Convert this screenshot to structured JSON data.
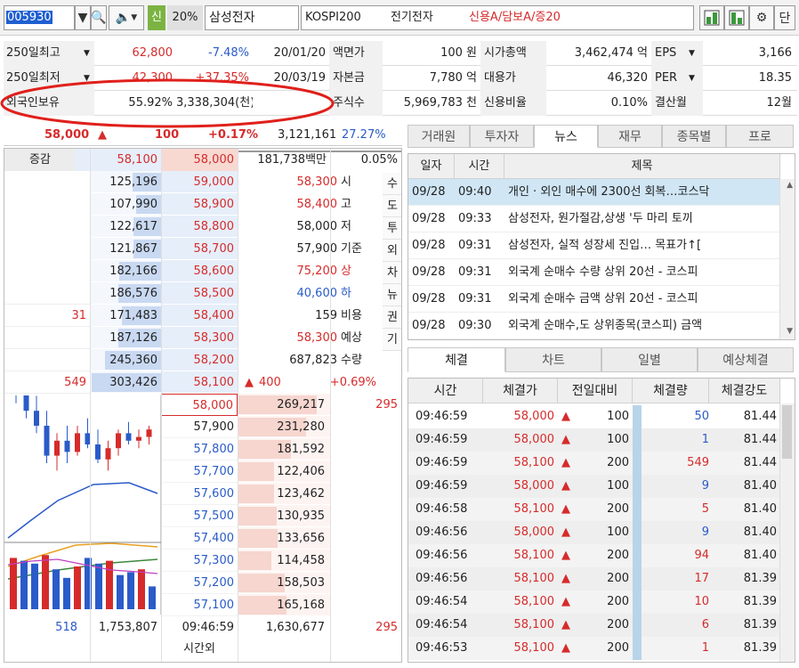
{
  "top": {
    "code": "005930",
    "badge_sin": "신",
    "margin_pct": "20%",
    "name": "삼성전자",
    "market": "KOSPI200",
    "sector": "전기전자",
    "credit": "신용A/담보A/증20",
    "end_label": "단"
  },
  "info": {
    "rows": [
      {
        "label": "250일최고",
        "v1": "62,800",
        "v2": "-7.48%",
        "v3": "20/01/20",
        "l2": "액면가",
        "v4": "100 원",
        "l3": "시가총액",
        "v5": "3,462,474 억",
        "l4": "EPS",
        "v6": "3,166"
      },
      {
        "label": "250일최저",
        "v1": "42,300",
        "v2": "+37.35%",
        "v3": "20/03/19",
        "l2": "자본금",
        "v4": "7,780 억",
        "l3": "대용가",
        "v5": "46,320",
        "l4": "PER",
        "v6": "18.35"
      },
      {
        "label": "외국인보유",
        "v1": "55.92%",
        "v2": "3,338,304(천)",
        "v3": "",
        "l2": "주식수",
        "v4": "5,969,783 천",
        "l3": "신용비율",
        "v5": "0.10%",
        "l4": "결산월",
        "v6": "12월"
      }
    ]
  },
  "price": {
    "current": "58,000",
    "arrow": "▲",
    "change": "100",
    "pct": "+0.17%",
    "volume": "3,121,161",
    "turnover": "27.27%"
  },
  "order_head": {
    "label": "증감",
    "ask_price": "58,100",
    "bid_price": "58,000",
    "amount": "181,738백만",
    "pct": "0.05%"
  },
  "asks": [
    {
      "qty": "125,196",
      "price": "59,000",
      "bar": 0.41
    },
    {
      "qty": "107,990",
      "price": "58,900",
      "bar": 0.36
    },
    {
      "qty": "122,617",
      "price": "58,800",
      "bar": 0.4
    },
    {
      "qty": "121,867",
      "price": "58,700",
      "bar": 0.4
    },
    {
      "qty": "182,166",
      "price": "58,600",
      "bar": 0.6
    },
    {
      "qty": "186,576",
      "price": "58,500",
      "bar": 0.62,
      "diff": ""
    },
    {
      "qty": "171,483",
      "price": "58,400",
      "bar": 0.57,
      "diff": "31"
    },
    {
      "qty": "187,126",
      "price": "58,300",
      "bar": 0.62,
      "diff": ""
    },
    {
      "qty": "245,360",
      "price": "58,200",
      "bar": 0.81,
      "diff": ""
    },
    {
      "qty": "303,426",
      "price": "58,100",
      "bar": 1.0,
      "diff": "549"
    }
  ],
  "stats": [
    {
      "val": "58,300",
      "lbl": "시"
    },
    {
      "val": "58,400",
      "lbl": "고"
    },
    {
      "val": "58,000",
      "lbl": "저"
    },
    {
      "val": "57,900",
      "lbl": "기준"
    },
    {
      "val": "75,200",
      "lbl": "상"
    },
    {
      "val": "40,600",
      "lbl": "하"
    },
    {
      "val": "159",
      "lbl": "비용"
    },
    {
      "val": "58,300",
      "lbl": "예상"
    },
    {
      "val": "687,823",
      "lbl": "수량"
    }
  ],
  "exp_change": {
    "arrow": "▲",
    "val": "400",
    "pct": "+0.69%"
  },
  "side_buttons": [
    "수",
    "도",
    "투",
    "외",
    "차",
    "뉴",
    "권",
    "기"
  ],
  "bids": [
    {
      "price": "58,000",
      "qty": "269,217",
      "diff": "295",
      "bar": 0.86
    },
    {
      "price": "57,900",
      "qty": "231,280",
      "diff": "",
      "bar": 0.74
    },
    {
      "price": "57,800",
      "qty": "181,592",
      "diff": "",
      "bar": 0.58
    },
    {
      "price": "57,700",
      "qty": "122,406",
      "diff": "",
      "bar": 0.39
    },
    {
      "price": "57,600",
      "qty": "123,462",
      "diff": "",
      "bar": 0.39
    },
    {
      "price": "57,500",
      "qty": "130,935",
      "diff": "",
      "bar": 0.42
    },
    {
      "price": "57,400",
      "qty": "133,656",
      "diff": "",
      "bar": 0.43
    },
    {
      "price": "57,300",
      "qty": "114,458",
      "diff": "",
      "bar": 0.37
    },
    {
      "price": "57,200",
      "qty": "158,503",
      "diff": "",
      "bar": 0.51
    },
    {
      "price": "57,100",
      "qty": "165,168",
      "diff": "",
      "bar": 0.53
    }
  ],
  "totals": {
    "ask_diff": "518",
    "ask_total": "1,753,807",
    "time": "09:46:59",
    "bid_total": "1,630,677",
    "bid_diff": "295",
    "after": "시간외"
  },
  "news": {
    "tabs": [
      "거래원",
      "투자자",
      "뉴스",
      "재무",
      "종목별",
      "프로"
    ],
    "active_tab": 2,
    "headers": [
      "일자",
      "시간",
      "제목"
    ],
    "rows": [
      {
        "date": "09/28",
        "time": "09:40",
        "title": "개인 · 외인 매수에 2300선 회복…코스닥"
      },
      {
        "date": "09/28",
        "time": "09:33",
        "title": "삼성전자, 원가절감,상생 '두 마리 토끼"
      },
      {
        "date": "09/28",
        "time": "09:31",
        "title": "삼성전자, 실적 성장세 진입… 목표가↑["
      },
      {
        "date": "09/28",
        "time": "09:31",
        "title": "외국계 순매수 수량 상위 20선 - 코스피"
      },
      {
        "date": "09/28",
        "time": "09:31",
        "title": "외국계 순매수 금액 상위 20선 - 코스피"
      },
      {
        "date": "09/28",
        "time": "09:30",
        "title": "외국계 순매수,도 상위종목(코스피) 금액"
      }
    ]
  },
  "trades": {
    "tabs": [
      "체결",
      "차트",
      "일별",
      "예상체결"
    ],
    "active_tab": 0,
    "headers": [
      "시간",
      "체결가",
      "전일대비",
      "체결량",
      "체결강도"
    ],
    "rows": [
      {
        "time": "09:46:59",
        "price": "58,000",
        "arrow": "▲",
        "diff": "100",
        "qty": "50",
        "qty_color": "blue",
        "strength": "81.44"
      },
      {
        "time": "09:46:59",
        "price": "58,000",
        "arrow": "▲",
        "diff": "100",
        "qty": "1",
        "qty_color": "blue",
        "strength": "81.44"
      },
      {
        "time": "09:46:59",
        "price": "58,100",
        "arrow": "▲",
        "diff": "200",
        "qty": "549",
        "qty_color": "red",
        "strength": "81.44"
      },
      {
        "time": "09:46:59",
        "price": "58,000",
        "arrow": "▲",
        "diff": "100",
        "qty": "9",
        "qty_color": "blue",
        "strength": "81.40"
      },
      {
        "time": "09:46:58",
        "price": "58,100",
        "arrow": "▲",
        "diff": "200",
        "qty": "5",
        "qty_color": "red",
        "strength": "81.40"
      },
      {
        "time": "09:46:56",
        "price": "58,000",
        "arrow": "▲",
        "diff": "100",
        "qty": "9",
        "qty_color": "blue",
        "strength": "81.40"
      },
      {
        "time": "09:46:56",
        "price": "58,100",
        "arrow": "▲",
        "diff": "200",
        "qty": "94",
        "qty_color": "red",
        "strength": "81.40"
      },
      {
        "time": "09:46:56",
        "price": "58,100",
        "arrow": "▲",
        "diff": "200",
        "qty": "17",
        "qty_color": "red",
        "strength": "81.39"
      },
      {
        "time": "09:46:54",
        "price": "58,100",
        "arrow": "▲",
        "diff": "200",
        "qty": "10",
        "qty_color": "red",
        "strength": "81.39"
      },
      {
        "time": "09:46:54",
        "price": "58,100",
        "arrow": "▲",
        "diff": "200",
        "qty": "6",
        "qty_color": "red",
        "strength": "81.39"
      },
      {
        "time": "09:46:53",
        "price": "58,100",
        "arrow": "▲",
        "diff": "200",
        "qty": "1",
        "qty_color": "red",
        "strength": "81.39"
      }
    ]
  },
  "colors": {
    "up": "#d62b2b",
    "down": "#2a5bc9",
    "ask_bg": "#e6eefa",
    "bid_bg": "#fbecec",
    "highlight": "#d0e6f5",
    "annotation": "#e0201b"
  },
  "mini_chart": {
    "candles": [
      [
        92,
        96,
        86,
        90
      ],
      [
        90,
        95,
        82,
        84
      ],
      [
        84,
        88,
        78,
        80
      ],
      [
        80,
        84,
        70,
        72
      ],
      [
        72,
        78,
        68,
        76
      ],
      [
        76,
        80,
        70,
        73
      ],
      [
        73,
        80,
        72,
        78
      ],
      [
        78,
        82,
        74,
        75
      ],
      [
        75,
        79,
        70,
        71
      ],
      [
        71,
        76,
        68,
        74
      ],
      [
        74,
        79,
        72,
        78
      ],
      [
        78,
        81,
        75,
        76
      ],
      [
        76,
        79,
        74,
        77
      ],
      [
        77,
        80,
        75,
        79
      ]
    ],
    "volume": [
      0.9,
      0.85,
      0.8,
      0.95,
      0.7,
      0.55,
      0.75,
      0.9,
      0.8,
      0.85,
      0.6,
      0.65,
      0.7,
      0.4
    ]
  }
}
